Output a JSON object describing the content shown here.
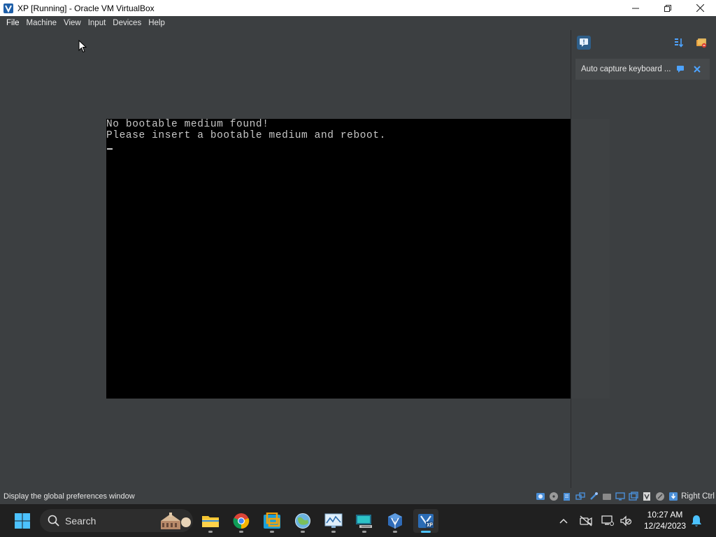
{
  "window": {
    "title": "XP [Running] - Oracle VM VirtualBox"
  },
  "menu": [
    {
      "label": "File"
    },
    {
      "label": "Machine"
    },
    {
      "label": "View"
    },
    {
      "label": "Input"
    },
    {
      "label": "Devices"
    },
    {
      "label": "Help"
    }
  ],
  "vm_screen": {
    "line1": "No bootable medium found!",
    "line2": "Please insert a bootable medium and reboot."
  },
  "notification": {
    "text": "Auto capture keyboard ..."
  },
  "statusbar": {
    "message": "Display the global preferences window",
    "host_key": "Right Ctrl"
  },
  "taskbar": {
    "search_placeholder": "Search",
    "time": "10:27 AM",
    "date": "12/24/2023"
  },
  "colors": {
    "vbox_background": "#3c3f41",
    "vm_screen": "#000000",
    "taskbar": "#202020",
    "accent": "#4cc2ff"
  }
}
